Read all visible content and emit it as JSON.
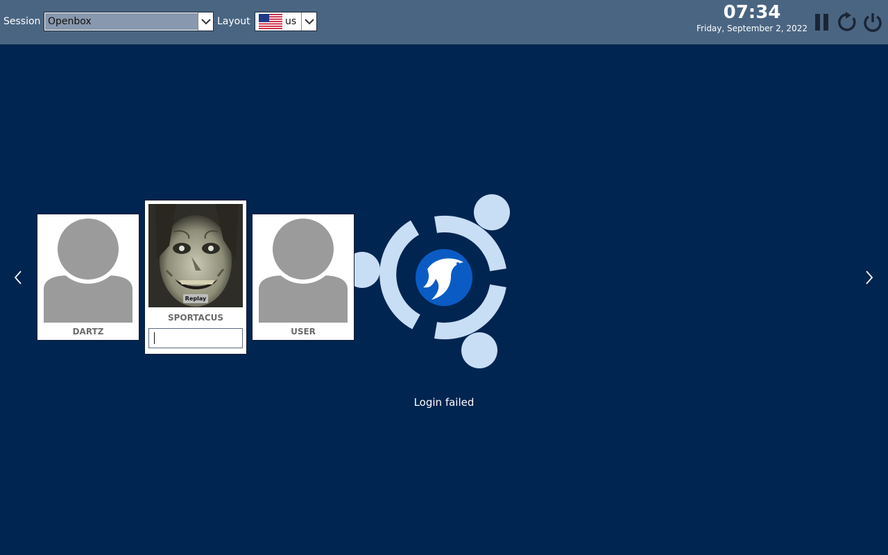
{
  "topbar": {
    "session_label": "Session",
    "session_value": "Openbox",
    "layout_label": "Layout",
    "layout_value": "us",
    "layout_flag_icon": "us-flag-icon",
    "time": "07:34",
    "date": "Friday, September 2, 2022",
    "buttons": [
      "suspend-icon",
      "restart-icon",
      "power-icon"
    ]
  },
  "users": [
    {
      "name": "DARTZ",
      "avatar": "default-avatar-icon"
    },
    {
      "name": "SPORTACUS",
      "avatar": "user-photo",
      "replay_label": "Replay",
      "selected": true,
      "password_value": ""
    },
    {
      "name": "USER",
      "avatar": "default-avatar-icon"
    }
  ],
  "status_message": "Login failed",
  "colors": {
    "background": "#002550",
    "topbar": "#4a6582",
    "logo_light": "#c8def5",
    "logo_blue": "#0a5cc4"
  }
}
